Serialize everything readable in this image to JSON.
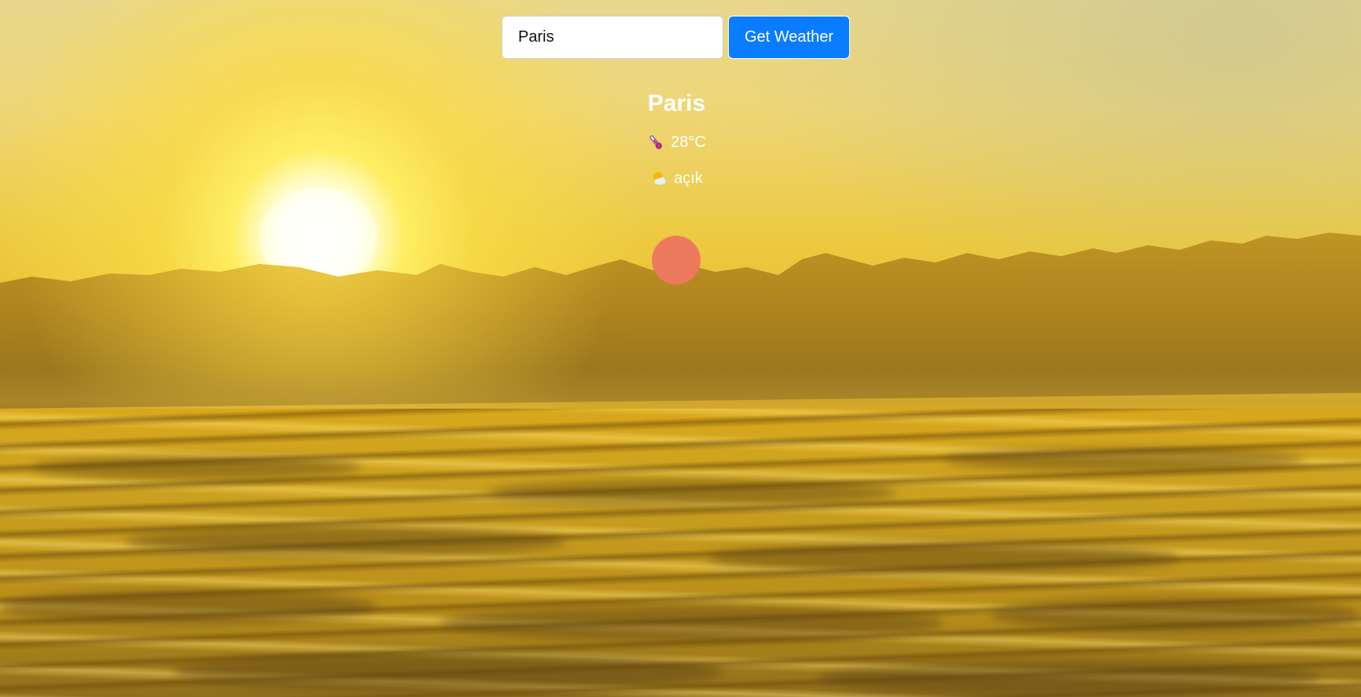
{
  "search": {
    "value": "Paris",
    "button_label": "Get Weather"
  },
  "weather": {
    "city": "Paris",
    "temperature": "28°C",
    "description": "açık",
    "temperature_icon": "thermometer-icon",
    "description_icon": "sun-behind-cloud-icon"
  },
  "colors": {
    "button": "#0a7cff",
    "weather_dot": "#ee7a5e",
    "text": "#ffffff"
  }
}
